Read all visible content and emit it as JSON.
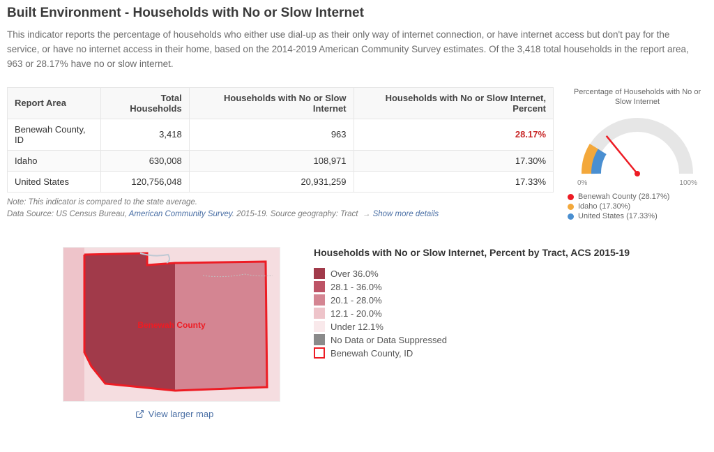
{
  "title": "Built Environment - Households with No or Slow Internet",
  "description": "This indicator reports the percentage of households who either use dial-up as their only way of internet connection, or have internet access but don't pay for the service, or have no internet access in their home, based on the 2014-2019 American Community Survey estimates. Of the 3,418 total households in the report area, 963 or 28.17% have no or slow internet.",
  "table": {
    "headers": [
      "Report Area",
      "Total Households",
      "Households with No or Slow Internet",
      "Households with No or Slow Internet, Percent"
    ],
    "rows": [
      {
        "area": "Benewah County, ID",
        "total": "3,418",
        "nos": "963",
        "pct": "28.17%",
        "highlight": true
      },
      {
        "area": "Idaho",
        "total": "630,008",
        "nos": "108,971",
        "pct": "17.30%",
        "highlight": false
      },
      {
        "area": "United States",
        "total": "120,756,048",
        "nos": "20,931,259",
        "pct": "17.33%",
        "highlight": false
      }
    ]
  },
  "note": {
    "line1": "Note: This indicator is compared to the state average.",
    "prefix": "Data Source: US Census Bureau, ",
    "source_link": "American Community Survey",
    "suffix": ". 2015-19. Source geography: Tract",
    "more": "Show more details"
  },
  "gauge": {
    "title": "Percentage of Households with No or Slow Internet",
    "tick0": "0%",
    "tick1": "100%",
    "legend": [
      {
        "color": "#ed1c24",
        "label": "Benewah County (28.17%)"
      },
      {
        "color": "#f3a83b",
        "label": "Idaho (17.30%)"
      },
      {
        "color": "#4a8fd1",
        "label": "United States (17.33%)"
      }
    ]
  },
  "map": {
    "label": "Benewah County",
    "link_text": "View larger map"
  },
  "map_legend": {
    "title": "Households with No or Slow Internet, Percent by Tract, ACS 2015-19",
    "items": [
      {
        "color": "#a13a4a",
        "label": "Over 36.0%"
      },
      {
        "color": "#bd5466",
        "label": "28.1 - 36.0%"
      },
      {
        "color": "#d48592",
        "label": "20.1 - 28.0%"
      },
      {
        "color": "#eec4ca",
        "label": "12.1 - 20.0%"
      },
      {
        "color": "#f9e9eb",
        "label": "Under 12.1%"
      },
      {
        "color": "#8a8a8a",
        "label": "No Data or Data Suppressed"
      }
    ],
    "outline": "Benewah County, ID"
  },
  "chart_data": {
    "type": "gauge",
    "title": "Percentage of Households with No or Slow Internet",
    "range": [
      0,
      100
    ],
    "unit": "%",
    "series": [
      {
        "name": "Benewah County",
        "value": 28.17,
        "color": "#ed1c24"
      },
      {
        "name": "Idaho",
        "value": 17.3,
        "color": "#f3a83b"
      },
      {
        "name": "United States",
        "value": 17.33,
        "color": "#4a8fd1"
      }
    ]
  }
}
